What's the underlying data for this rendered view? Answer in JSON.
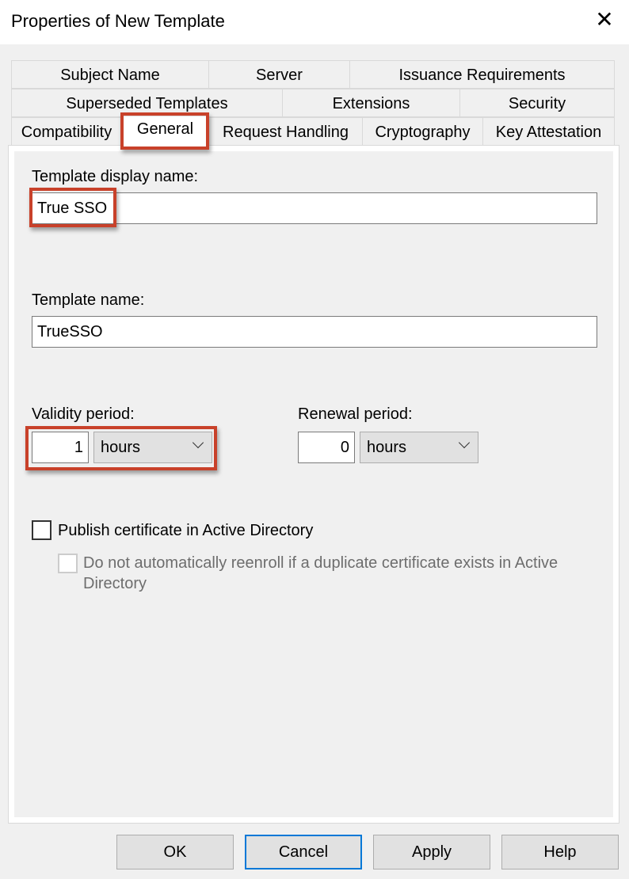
{
  "window": {
    "title": "Properties of New Template",
    "close_icon": "close-icon"
  },
  "tabs": {
    "row1": [
      "Subject Name",
      "Server",
      "Issuance Requirements"
    ],
    "row2": [
      "Superseded Templates",
      "Extensions",
      "Security"
    ],
    "row3": [
      "Compatibility",
      "General",
      "Request Handling",
      "Cryptography",
      "Key Attestation"
    ],
    "selected": "General"
  },
  "general": {
    "display_name_label": "Template display name:",
    "display_name_value": "True SSO",
    "template_name_label": "Template name:",
    "template_name_value": "TrueSSO",
    "validity_label": "Validity period:",
    "validity_value": "1",
    "validity_unit": "hours",
    "renewal_label": "Renewal period:",
    "renewal_value": "0",
    "renewal_unit": "hours",
    "publish_label": "Publish certificate in Active Directory",
    "publish_checked": false,
    "reenroll_label_line1": "Do not automatically reenroll if a duplicate certificate exists in Active",
    "reenroll_label_line2": "Directory",
    "reenroll_checked": false,
    "reenroll_disabled": true
  },
  "highlight_color": "#c8412a",
  "buttons": {
    "ok": "OK",
    "cancel": "Cancel",
    "apply": "Apply",
    "help": "Help"
  }
}
